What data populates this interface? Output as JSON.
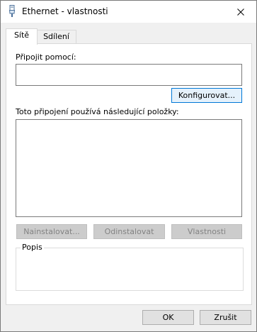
{
  "window": {
    "title": "Ethernet - vlastnosti",
    "icon": "network-adapter-icon"
  },
  "tabs": [
    {
      "label": "Sítě",
      "active": true
    },
    {
      "label": "Sdílení",
      "active": false
    }
  ],
  "connect_using": {
    "label": "Připojit pomocí:",
    "value": ""
  },
  "configure_button": {
    "label": "Konfigurovat..."
  },
  "items_list": {
    "label": "Toto připojení používá následující položky:",
    "items": []
  },
  "actions": {
    "install": "Nainstalovat...",
    "uninstall": "Odinstalovat",
    "properties": "Vlastnosti"
  },
  "description": {
    "title": "Popis",
    "text": ""
  },
  "footer": {
    "ok": "OK",
    "cancel": "Zrušit"
  },
  "colors": {
    "accent": "#0078d7"
  }
}
